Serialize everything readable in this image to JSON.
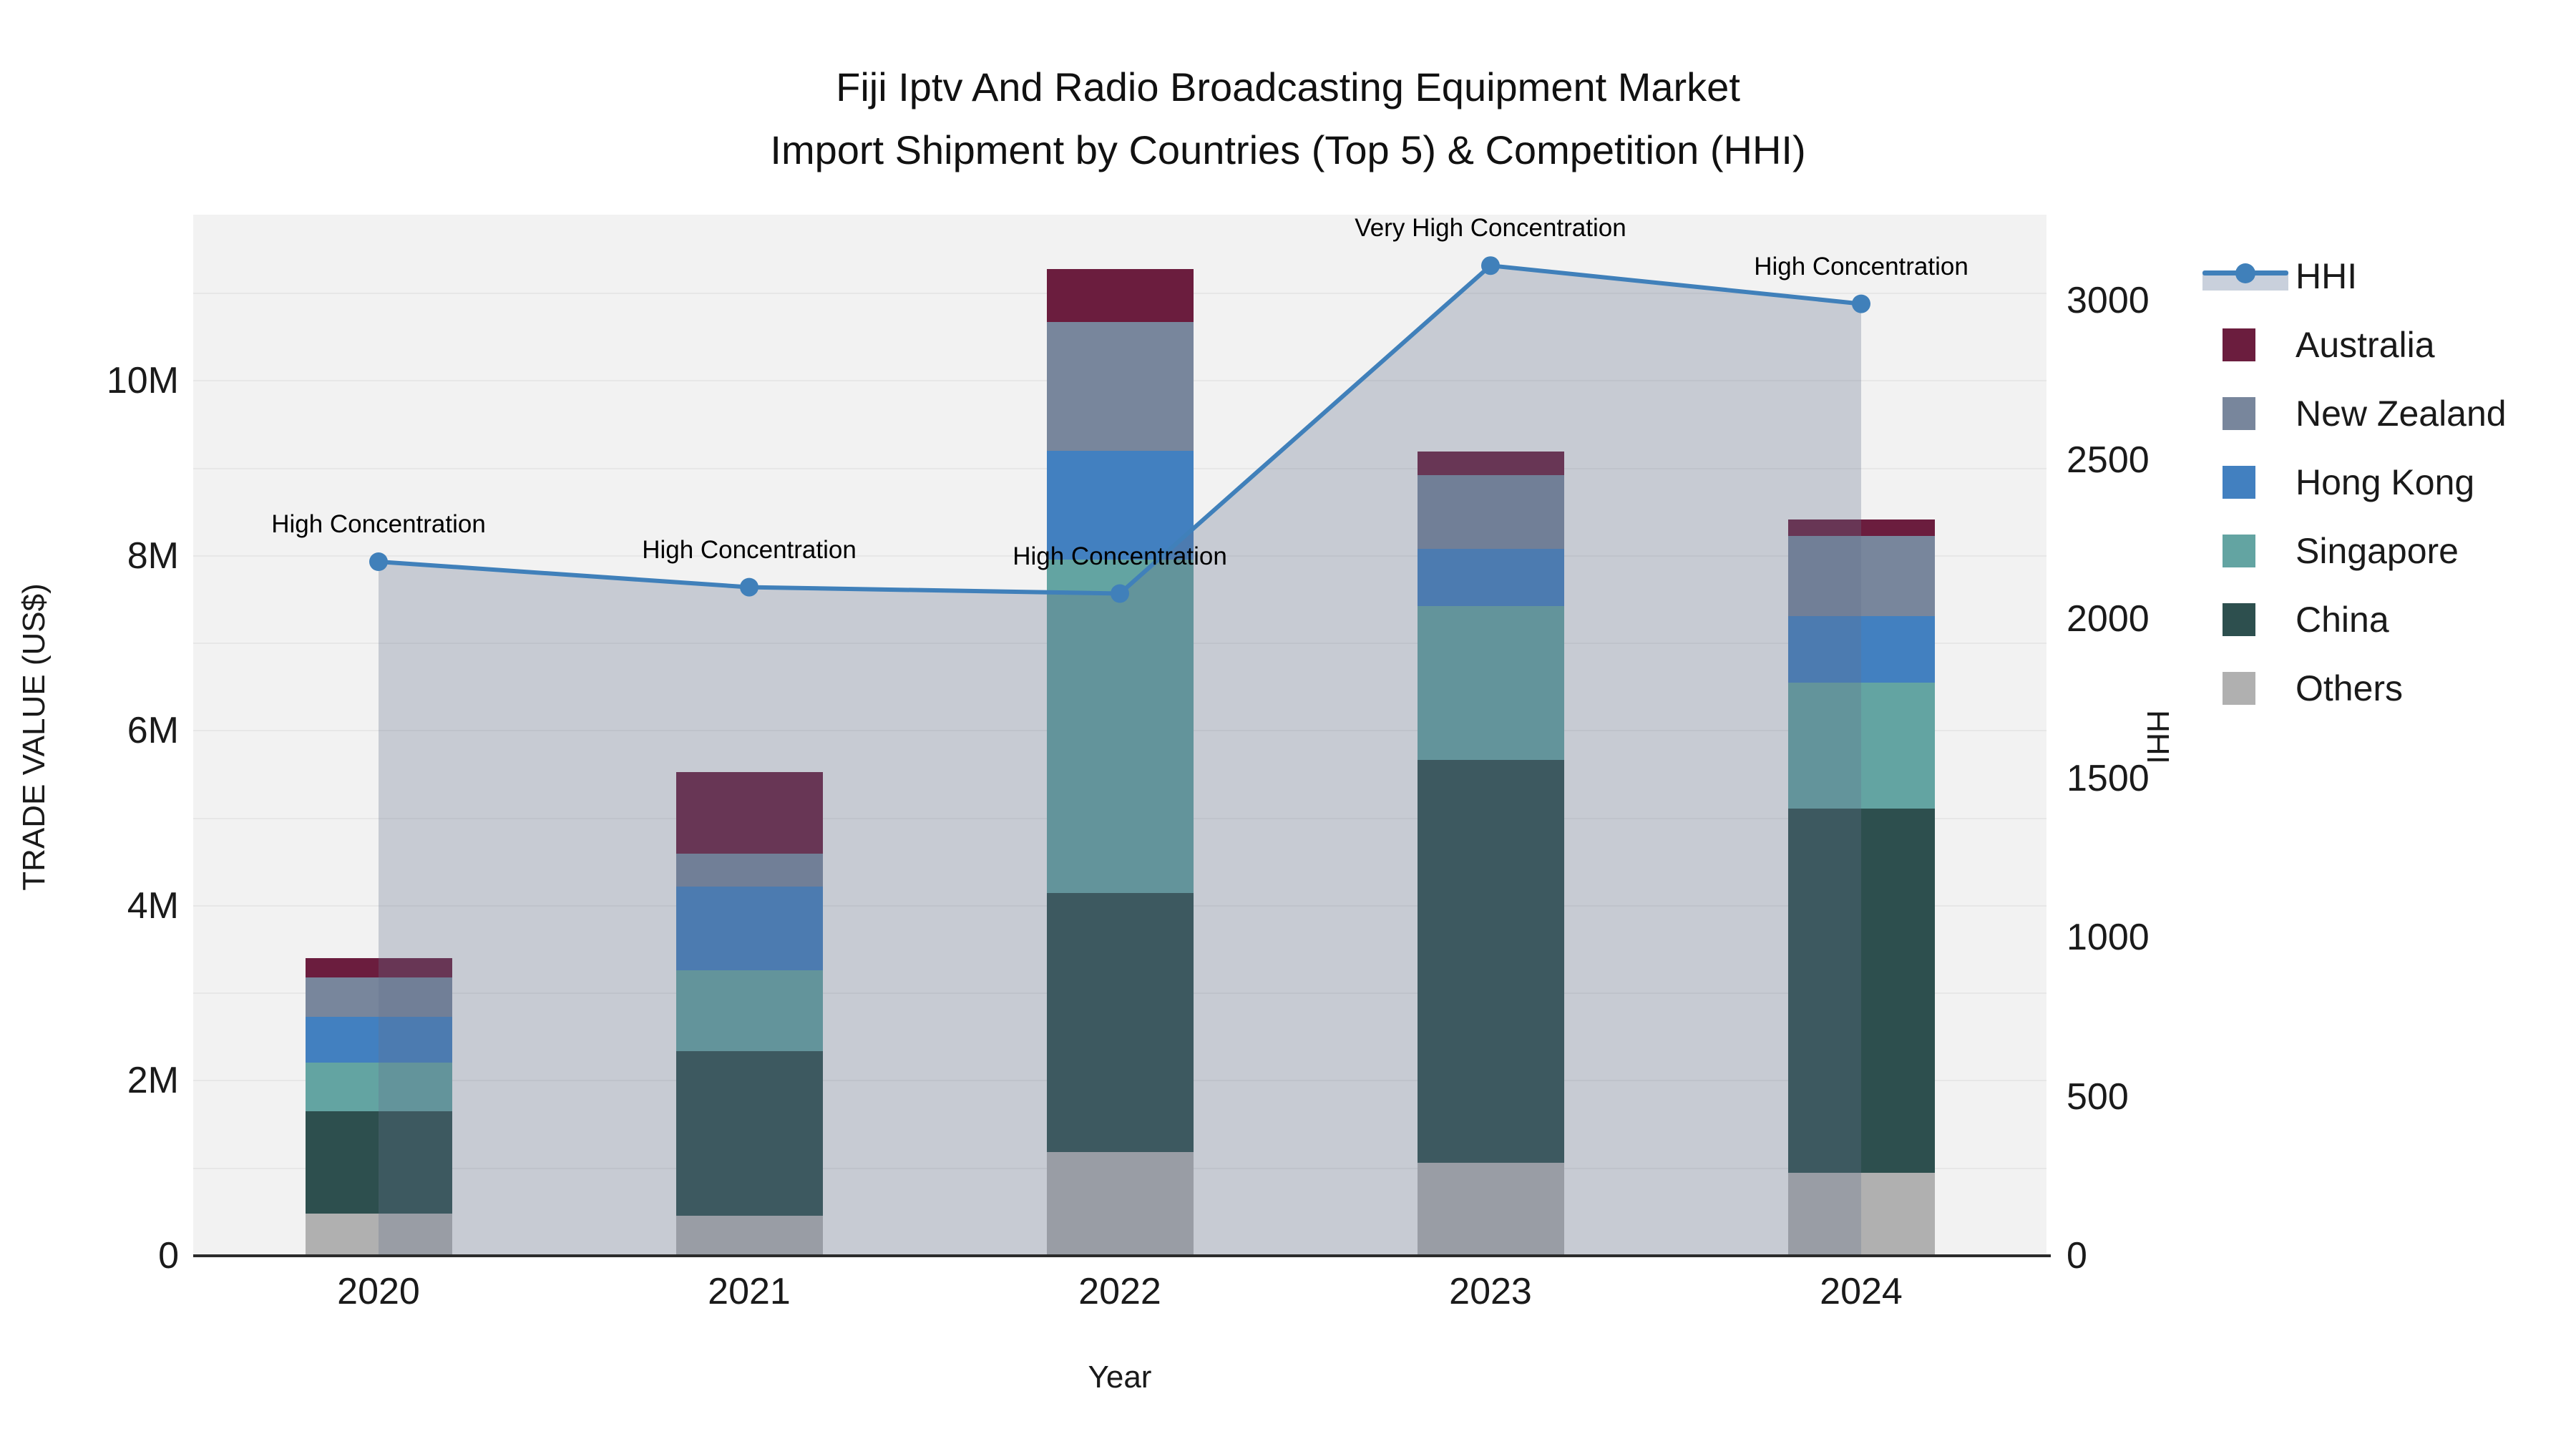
{
  "title": {
    "line1": "Fiji Iptv And Radio Broadcasting Equipment Market",
    "line2": "Import Shipment by Countries (Top 5) & Competition (HHI)"
  },
  "chart_data": {
    "type": "bar",
    "subtype": "stacked-bar-with-line-overlay",
    "categories": [
      "2020",
      "2021",
      "2022",
      "2023",
      "2024"
    ],
    "value_unit": "million US$",
    "series": [
      {
        "name": "Others",
        "color": "#b0b0b0",
        "values": [
          0.48,
          0.46,
          1.19,
          1.06,
          0.95
        ]
      },
      {
        "name": "China",
        "color": "#2d4f4e",
        "values": [
          1.17,
          1.88,
          2.96,
          4.61,
          4.16
        ]
      },
      {
        "name": "Singapore",
        "color": "#63a4a2",
        "values": [
          0.56,
          0.92,
          3.81,
          1.76,
          1.44
        ]
      },
      {
        "name": "Hong Kong",
        "color": "#4280c0",
        "values": [
          0.52,
          0.96,
          1.24,
          0.65,
          0.76
        ]
      },
      {
        "name": "New Zealand",
        "color": "#78869c",
        "values": [
          0.45,
          0.38,
          1.47,
          0.84,
          0.92
        ]
      },
      {
        "name": "Australia",
        "color": "#6b1d3e",
        "values": [
          0.22,
          0.93,
          0.61,
          0.27,
          0.19
        ]
      }
    ],
    "bar_totals": [
      3.4,
      5.53,
      11.28,
      9.19,
      8.42
    ],
    "line": {
      "name": "HHI",
      "color": "#4080ba",
      "area_fill": "rgba(100,112,140,0.30)",
      "values": [
        2180,
        2100,
        2080,
        3110,
        2990
      ]
    },
    "annotations": [
      {
        "category": "2020",
        "text": "High Concentration"
      },
      {
        "category": "2021",
        "text": "High Concentration"
      },
      {
        "category": "2022",
        "text": "High Concentration"
      },
      {
        "category": "2023",
        "text": "Very High Concentration"
      },
      {
        "category": "2024",
        "text": "High Concentration"
      }
    ],
    "xlabel": "Year",
    "ylabel_left": "TRADE VALUE (US$)",
    "ylabel_right": "HHI",
    "yticks_left": [
      {
        "label": "0",
        "value": 0
      },
      {
        "label": "2M",
        "value": 2
      },
      {
        "label": "4M",
        "value": 4
      },
      {
        "label": "6M",
        "value": 6
      },
      {
        "label": "8M",
        "value": 8
      },
      {
        "label": "10M",
        "value": 10
      }
    ],
    "yticks_right": [
      {
        "label": "0",
        "value": 0
      },
      {
        "label": "500",
        "value": 500
      },
      {
        "label": "1000",
        "value": 1000
      },
      {
        "label": "1500",
        "value": 1500
      },
      {
        "label": "2000",
        "value": 2000
      },
      {
        "label": "2500",
        "value": 2500
      },
      {
        "label": "3000",
        "value": 3000
      }
    ],
    "ylim_left": [
      0,
      11.9
    ],
    "ylim_right": [
      0,
      3270
    ],
    "grid": true,
    "legend_position": "right"
  },
  "legend": {
    "items": [
      {
        "label": "HHI",
        "kind": "line",
        "color": "#4080ba",
        "band": "#c9d0dc"
      },
      {
        "label": "Australia",
        "kind": "swatch",
        "color": "#6b1d3e"
      },
      {
        "label": "New Zealand",
        "kind": "swatch",
        "color": "#78869c"
      },
      {
        "label": "Hong Kong",
        "kind": "swatch",
        "color": "#4280c0"
      },
      {
        "label": "Singapore",
        "kind": "swatch",
        "color": "#63a4a2"
      },
      {
        "label": "China",
        "kind": "swatch",
        "color": "#2d4f4e"
      },
      {
        "label": "Others",
        "kind": "swatch",
        "color": "#b0b0b0"
      }
    ]
  },
  "colors": {
    "plot_background": "#f2f2f2",
    "figure_background": "#ffffff",
    "axis_line": "#2b2b2b",
    "text": "#1a1a1a"
  }
}
